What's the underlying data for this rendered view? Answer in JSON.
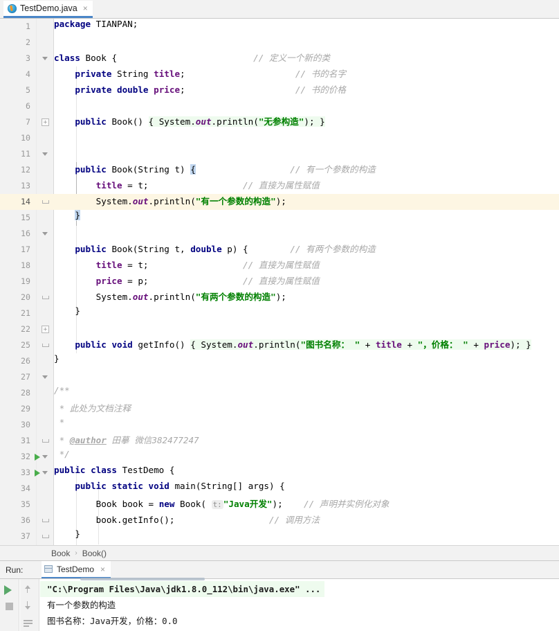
{
  "tab": {
    "filename": "TestDemo.java",
    "icon": "java-class-icon",
    "close": "×"
  },
  "editor": {
    "current_line": 14,
    "lines": [
      {
        "n": "1",
        "fold": "",
        "run": false,
        "indent": 0
      },
      {
        "n": "2",
        "fold": "",
        "run": false,
        "indent": 0
      },
      {
        "n": "3",
        "fold": "tri",
        "run": false,
        "indent": 0
      },
      {
        "n": "4",
        "fold": "",
        "run": false,
        "indent": 1
      },
      {
        "n": "5",
        "fold": "",
        "run": false,
        "indent": 1
      },
      {
        "n": "6",
        "fold": "",
        "run": false,
        "indent": 1
      },
      {
        "n": "7",
        "fold": "box",
        "run": false,
        "indent": 1
      },
      {
        "n": "10",
        "fold": "",
        "run": false,
        "indent": 1
      },
      {
        "n": "11",
        "fold": "tri",
        "run": false,
        "indent": 1
      },
      {
        "n": "12",
        "fold": "",
        "run": false,
        "indent": 2
      },
      {
        "n": "13",
        "fold": "",
        "run": false,
        "indent": 2
      },
      {
        "n": "14",
        "fold": "end",
        "run": false,
        "indent": 1
      },
      {
        "n": "15",
        "fold": "",
        "run": false,
        "indent": 1
      },
      {
        "n": "16",
        "fold": "tri",
        "run": false,
        "indent": 1
      },
      {
        "n": "17",
        "fold": "",
        "run": false,
        "indent": 2
      },
      {
        "n": "18",
        "fold": "",
        "run": false,
        "indent": 2
      },
      {
        "n": "19",
        "fold": "",
        "run": false,
        "indent": 2
      },
      {
        "n": "20",
        "fold": "end",
        "run": false,
        "indent": 1
      },
      {
        "n": "21",
        "fold": "",
        "run": false,
        "indent": 1
      },
      {
        "n": "22",
        "fold": "box",
        "run": false,
        "indent": 1
      },
      {
        "n": "25",
        "fold": "end",
        "run": false,
        "indent": 0
      },
      {
        "n": "26",
        "fold": "",
        "run": false,
        "indent": 0
      },
      {
        "n": "27",
        "fold": "tri",
        "run": false,
        "indent": 0
      },
      {
        "n": "28",
        "fold": "",
        "run": false,
        "indent": 0
      },
      {
        "n": "29",
        "fold": "",
        "run": false,
        "indent": 0
      },
      {
        "n": "30",
        "fold": "",
        "run": false,
        "indent": 0
      },
      {
        "n": "31",
        "fold": "end",
        "run": false,
        "indent": 0
      },
      {
        "n": "32",
        "fold": "tri",
        "run": true,
        "indent": 0
      },
      {
        "n": "33",
        "fold": "tri",
        "run": true,
        "indent": 1
      },
      {
        "n": "34",
        "fold": "",
        "run": false,
        "indent": 2
      },
      {
        "n": "35",
        "fold": "",
        "run": false,
        "indent": 2
      },
      {
        "n": "36",
        "fold": "end",
        "run": false,
        "indent": 1
      },
      {
        "n": "37",
        "fold": "end",
        "run": false,
        "indent": 0
      }
    ],
    "source_text": [
      "package TIANPAN;",
      "",
      "class Book {                          // 定义一个新的类",
      "    private String title;                     // 书的名字",
      "    private double price;                     // 书的价格",
      "",
      "    public Book() { System.out.println(\"无参构造\"); }",
      "",
      "    public Book(String t) {               // 有一个参数的构造",
      "        title = t;                    // 直接为属性赋值",
      "        System.out.println(\"有一个参数的构造\");",
      "    }",
      "",
      "    public Book(String t, double p) {     // 有两个参数的构造",
      "        title = t;                    // 直接为属性赋值",
      "        price = p;                    // 直接为属性赋值",
      "        System.out.println(\"有两个参数的构造\");",
      "    }",
      "",
      "    public void getInfo() { System.out.println(\"图书名称：\" + title + \"，价格：\" + price); }",
      "}",
      "",
      "/**",
      " * 此处为文档注释",
      " *",
      " * @author 田摹 微信382477247",
      " */",
      "public class TestDemo {",
      "    public static void main(String[] args) {",
      "        Book book = new Book( t: \"Java开发\");     // 声明并实例化对象",
      "        book.getInfo();                    // 调用方法",
      "    }",
      "}"
    ],
    "tokens": {
      "kw_package": "package",
      "pkg_name": "TIANPAN",
      "kw_class": "class",
      "name_book": "Book",
      "kw_private": "private",
      "type_string": "String",
      "fld_title": "title",
      "kw_double": "double",
      "fld_price": "price",
      "kw_public": "public",
      "kw_static": "static",
      "kw_void": "void",
      "kw_new": "new",
      "name_system": "System",
      "name_out": "out",
      "name_println": "println",
      "name_getinfo": "getInfo",
      "name_main": "main",
      "name_args": "args",
      "name_testdemo": "TestDemo",
      "name_book_var": "book",
      "str_noarg": "\"无参构造\"",
      "str_onearg": "\"有一个参数的构造\"",
      "str_twoarg": "\"有两个参数的构造\"",
      "str_bookname": "\"图书名称： \"",
      "str_priceprefix": "\"，价格： \"",
      "str_javadev": "\"Java开发\"",
      "hint_t": "t:",
      "cmt_newclass": "// 定义一个新的类",
      "cmt_bookname": "// 书的名字",
      "cmt_bookprice": "// 书的价格",
      "cmt_onearg": "// 有一个参数的构造",
      "cmt_assign": "// 直接为属性赋值",
      "cmt_twoarg": "// 有两个参数的构造",
      "cmt_declare": "// 声明并实例化对象",
      "cmt_callmethod": "// 调用方法",
      "doc_open": "/**",
      "doc_line1": "* 此处为文档注释",
      "doc_star": "*",
      "doc_author_tag": "@author",
      "doc_author_value": "田摹 微信382477247",
      "doc_close": "*/"
    }
  },
  "breadcrumb": {
    "items": [
      "Book",
      "Book()"
    ],
    "separator": "›"
  },
  "run_panel": {
    "label": "Run:",
    "tab_title": "TestDemo",
    "tab_close": "×",
    "toolbar": [
      "rerun-button",
      "stop-button",
      "screenshot-button",
      "up-button",
      "down-button",
      "soft-wrap-button"
    ],
    "console_lines": [
      "\"C:\\Program Files\\Java\\jdk1.8.0_112\\bin\\java.exe\" ...",
      "有一个参数的构造",
      "图书名称：Java开发，价格：0.0"
    ]
  },
  "colors": {
    "keyword": "#000080",
    "string": "#008000",
    "comment": "#a8a8a8",
    "field": "#660e7a",
    "tab_accent": "#4a86c8",
    "run_green": "#59a869",
    "current_line": "#fdf6e3"
  }
}
